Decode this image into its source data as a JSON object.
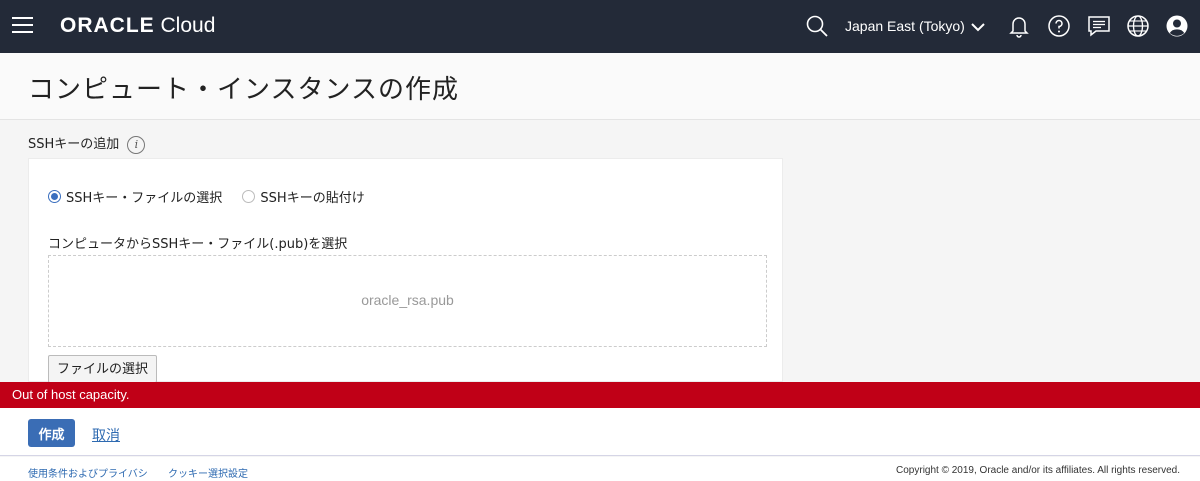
{
  "header": {
    "logo_brand": "ORACLE",
    "logo_product": "Cloud",
    "region": "Japan East (Tokyo)"
  },
  "page": {
    "title": "コンピュート・インスタンスの作成"
  },
  "ssh": {
    "section_label": "SSHキーの追加",
    "info_glyph": "i",
    "options": [
      {
        "label": "SSHキー・ファイルの選択",
        "selected": true
      },
      {
        "label": "SSHキーの貼付け",
        "selected": false
      }
    ],
    "file_label": "コンピュータからSSHキー・ファイル(.pub)を選択",
    "file_name": "oracle_rsa.pub",
    "choose_file_label": "ファイルの選択"
  },
  "error": {
    "message": "Out of host capacity."
  },
  "actions": {
    "create_label": "作成",
    "cancel_label": "取消"
  },
  "footer": {
    "terms_link": "使用条件およびプライバシ",
    "cookie_link": "クッキー選択設定",
    "copyright": "Copyright © 2019, Oracle and/or its affiliates. All rights reserved."
  },
  "colors": {
    "topbar": "#232a38",
    "error": "#c00017",
    "primary": "#3a6db5",
    "link": "#2e6ab1"
  }
}
